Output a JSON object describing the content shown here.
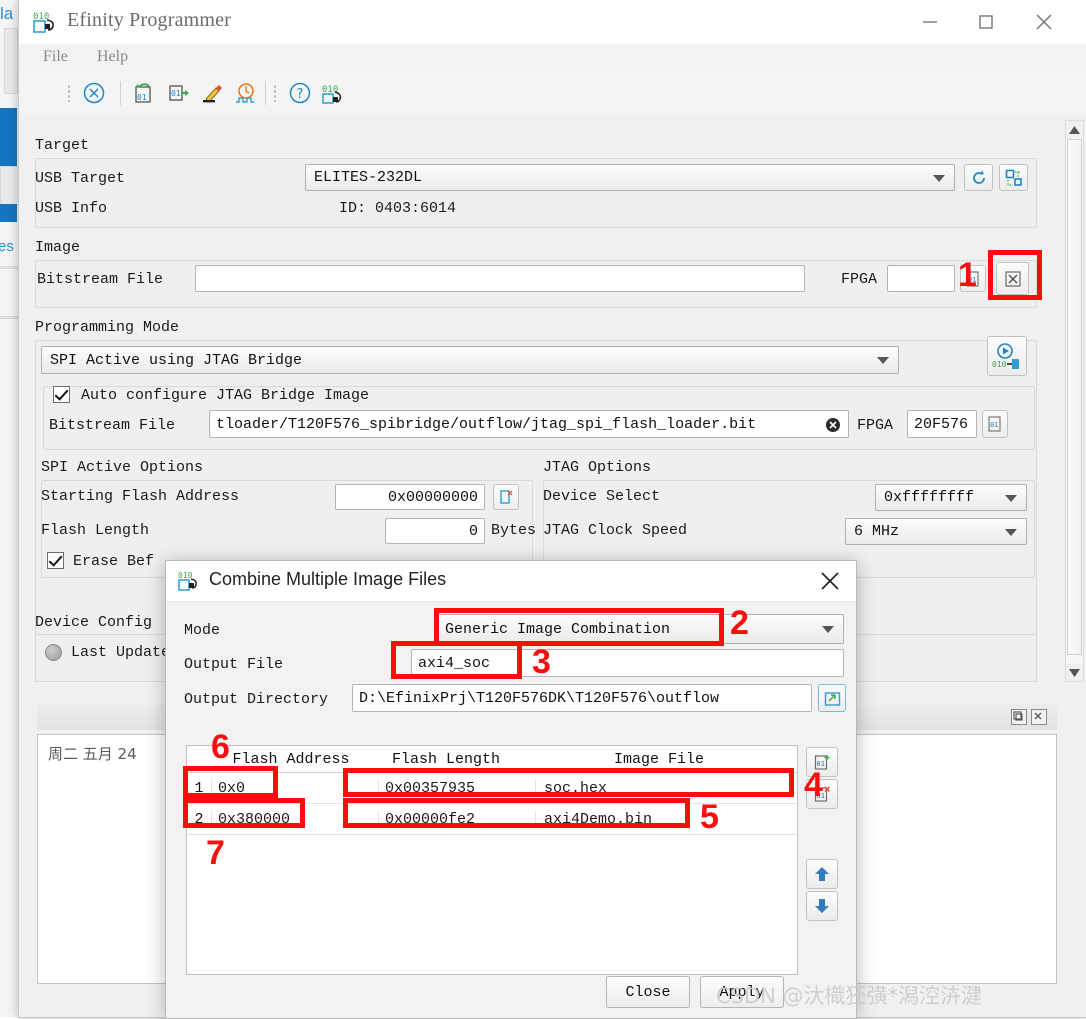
{
  "window": {
    "title": "Efinity Programmer",
    "app_icon": "binary-arrow-icon",
    "minimize": "minimize-icon",
    "maximize": "maximize-icon",
    "close": "close-icon"
  },
  "menubar": {
    "items": [
      "File",
      "Help"
    ]
  },
  "toolbar": {
    "icons": [
      "cancel-circle-icon",
      "refresh-device-icon",
      "export-device-icon",
      "edit-pencil-icon",
      "clock-waveform-icon",
      "help-circle-icon",
      "binary-arrow-icon"
    ]
  },
  "target": {
    "group_label": "Target",
    "usb_target_label": "USB Target",
    "usb_target_value": "ELITES-232DL",
    "usb_info_label": "USB Info",
    "usb_info_value": "ID: 0403:6014",
    "refresh_icon": "refresh-icon",
    "scan_icon": "scan-chain-icon"
  },
  "image": {
    "group_label": "Image",
    "bitstream_label": "Bitstream File",
    "bitstream_value": "",
    "bitstream_placeholder": "",
    "fpga_label": "FPGA",
    "fpga_value": "",
    "fpga_btn_icon": "bitstream-info-icon",
    "combine_btn_icon": "combine-images-icon"
  },
  "programming_mode": {
    "group_label": "Programming Mode",
    "mode_value": "SPI Active using JTAG Bridge",
    "run_btn_icon": "program-run-icon",
    "auto_configure_label": "Auto configure JTAG Bridge Image",
    "auto_configure_checked": true,
    "jtag_bitstream_label": "Bitstream File",
    "jtag_bitstream_value": "tloader/T120F576_spibridge/outflow/jtag_spi_flash_loader.bit",
    "jtag_clear_icon": "clear-field-icon",
    "jtag_fpga_label": "FPGA",
    "jtag_fpga_value": "20F576",
    "jtag_fpga_btn_icon": "bitstream-info-icon"
  },
  "spi_active_options": {
    "group_label": "SPI Active Options",
    "starting_flash_address_label": "Starting Flash Address",
    "starting_flash_address_value": "0x00000000",
    "starting_flash_address_btn_icon": "flash-address-clear-icon",
    "flash_length_label": "Flash Length",
    "flash_length_value": "0",
    "flash_length_unit": "Bytes",
    "flash_length_btn_icon": "flash-length-detect-icon",
    "erase_before_label": "Erase Bef",
    "erase_before_checked": true
  },
  "jtag_options": {
    "group_label": "JTAG Options",
    "device_select_label": "Device Select",
    "device_select_value": "0xffffffff",
    "clock_speed_label": "JTAG Clock Speed",
    "clock_speed_value": "6 MHz"
  },
  "device_config": {
    "group_label": "Device Config",
    "last_update_label": "Last Update",
    "status_icon": "status-dot-icon"
  },
  "log_panel": {
    "float_icon": "float-panel-icon",
    "close_icon": "close-panel-icon",
    "text": "周二 五月 24"
  },
  "dialog": {
    "icon": "binary-arrow-icon",
    "title": "Combine Multiple Image Files",
    "close_icon": "close-icon",
    "mode_label": "Mode",
    "mode_value": "Generic Image Combination",
    "output_file_label": "Output File",
    "output_file_value": "axi4_soc",
    "output_dir_label": "Output Directory",
    "output_dir_value": "D:\\EfinixPrj\\T120F576DK\\T120F576\\outflow",
    "browse_icon": "folder-browse-icon",
    "table": {
      "headers": [
        "Flash Address",
        "Flash Length",
        "Image File"
      ],
      "rows": [
        {
          "index": "1",
          "flash_address": "0x0",
          "flash_length": "0x00357935",
          "image_file": "soc.hex"
        },
        {
          "index": "2",
          "flash_address": "0x380000",
          "flash_length": "0x00000fe2",
          "image_file": "axi4Demo.bin"
        }
      ]
    },
    "side_buttons": [
      {
        "name": "add-image-button",
        "icon": "add-image-icon"
      },
      {
        "name": "remove-image-button",
        "icon": "remove-image-icon"
      },
      {
        "name": "move-up-button",
        "icon": "arrow-up-icon"
      },
      {
        "name": "move-down-button",
        "icon": "arrow-down-icon"
      }
    ],
    "close_button": "Close",
    "apply_button": "Apply"
  },
  "annotations": {
    "color": "#fc0d0d",
    "numbers": [
      "1",
      "2",
      "3",
      "4",
      "5",
      "6",
      "7"
    ]
  },
  "watermark": "CSDN @汏樴狉彉*潟涳泋湕"
}
